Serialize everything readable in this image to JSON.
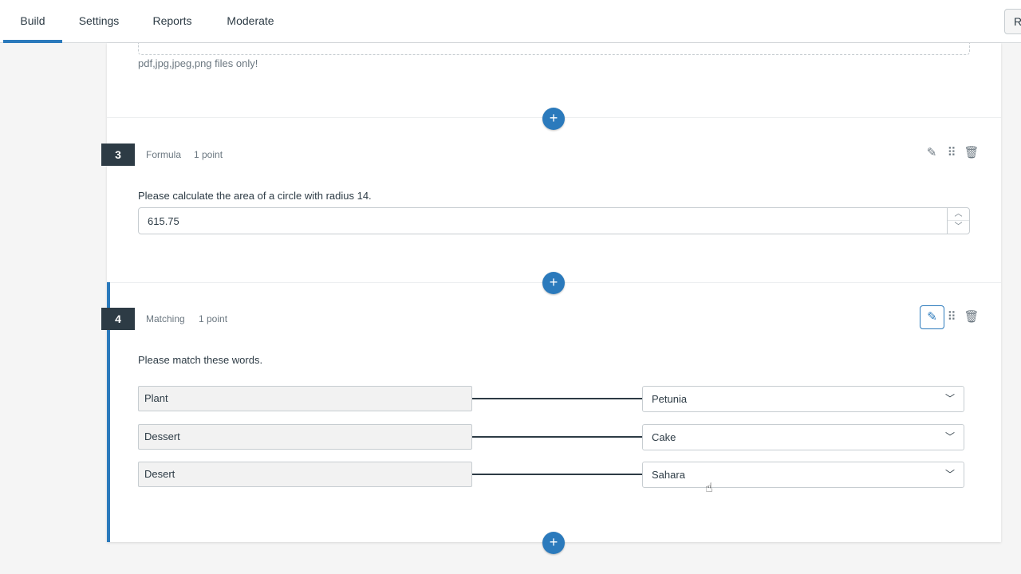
{
  "nav": {
    "tabs": [
      {
        "label": "Build",
        "active": true
      },
      {
        "label": "Settings"
      },
      {
        "label": "Reports"
      },
      {
        "label": "Moderate"
      }
    ],
    "right_button_label": "R"
  },
  "upload": {
    "files_note": "pdf,jpg,jpeg,png files only!"
  },
  "questions": [
    {
      "number": "3",
      "type": "Formula",
      "points": "1 point",
      "text": "Please calculate the area of a circle with radius 14.",
      "answer": "615.75"
    },
    {
      "number": "4",
      "type": "Matching",
      "points": "1 point",
      "text": "Please match these words.",
      "pairs": [
        {
          "left": "Plant",
          "right": "Petunia"
        },
        {
          "left": "Dessert",
          "right": "Cake"
        },
        {
          "left": "Desert",
          "right": "Sahara"
        }
      ]
    }
  ],
  "icons": {
    "add": "plus-icon",
    "edit": "pencil-icon",
    "drag": "drag-handle-icon",
    "delete": "trash-icon",
    "dropdown": "chevron-down-icon"
  },
  "colors": {
    "accent": "#2b7abc",
    "question_badge": "#2d3b45"
  }
}
